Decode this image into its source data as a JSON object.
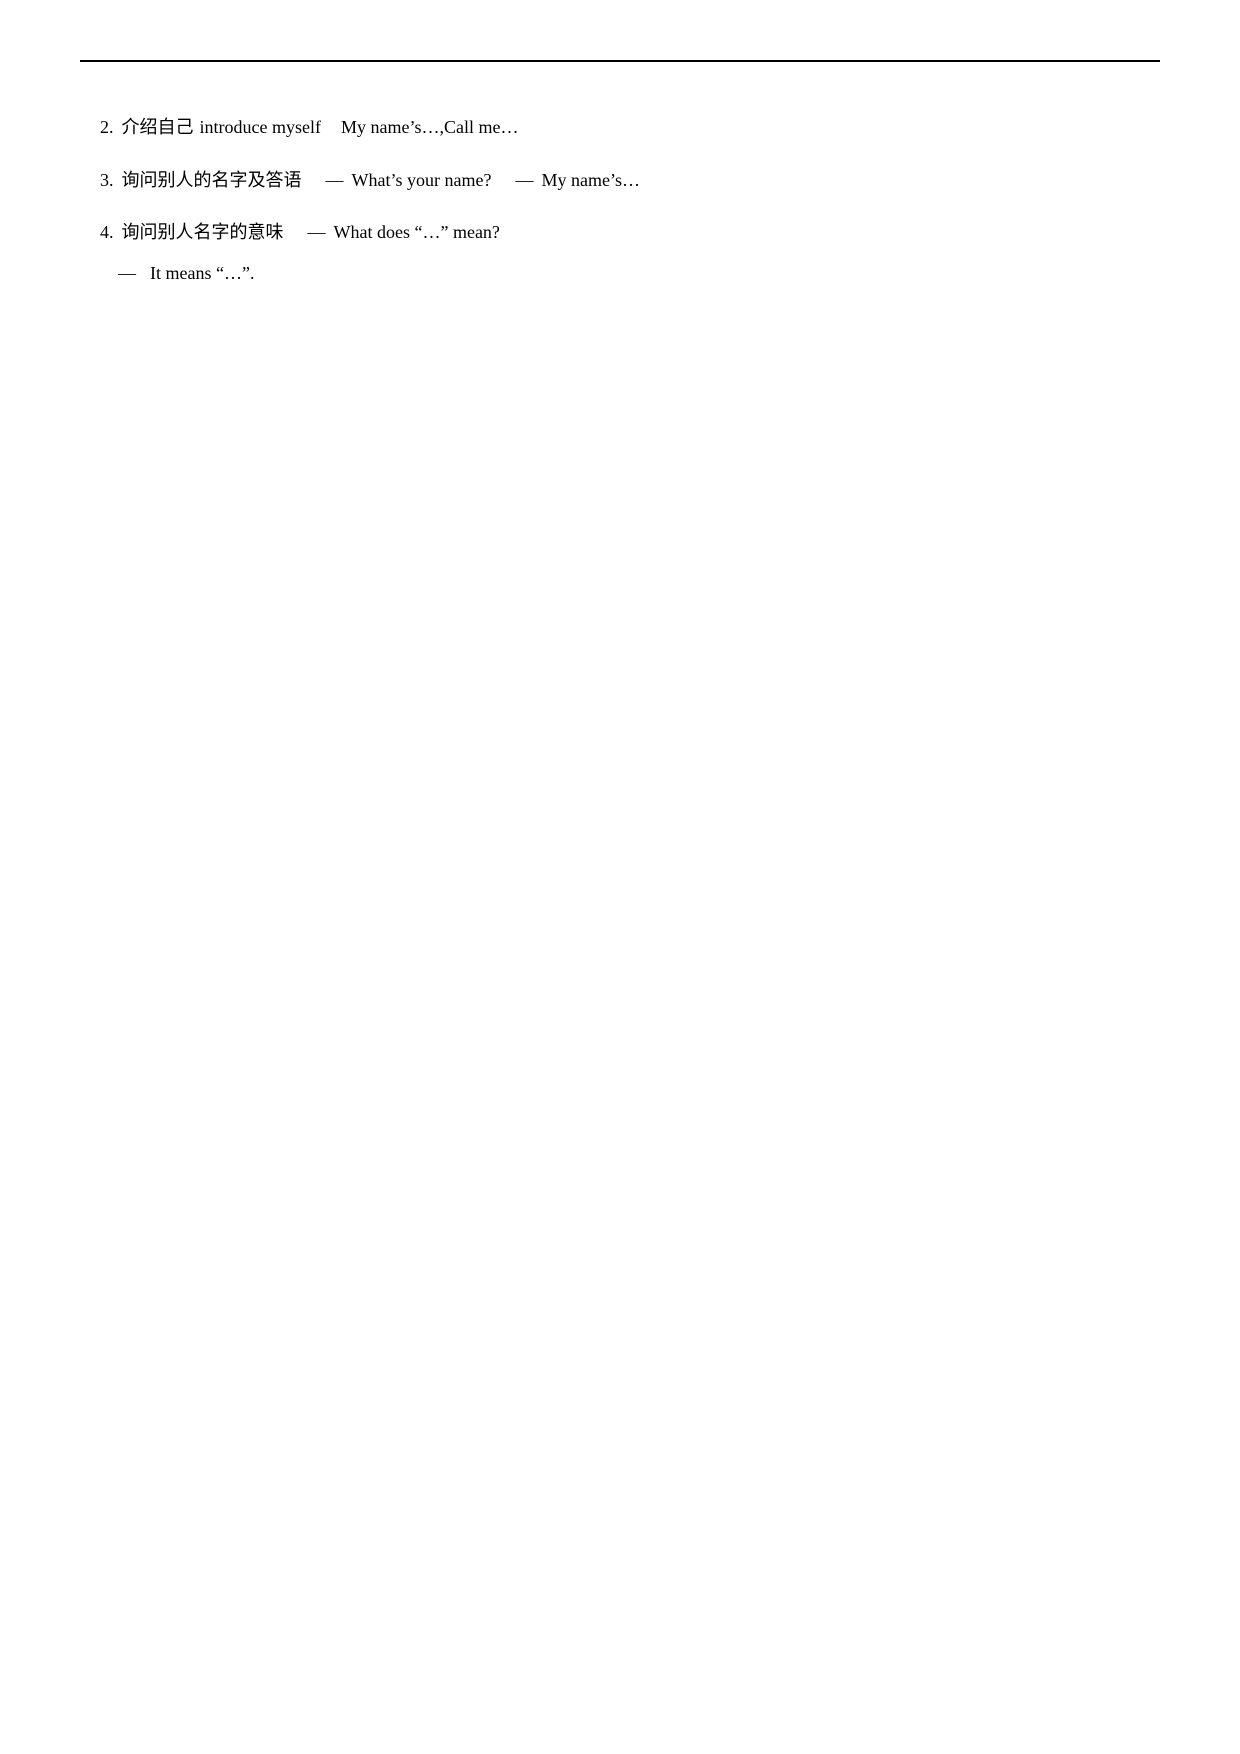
{
  "divider": true,
  "lines": [
    {
      "id": "line2",
      "number": "2.",
      "zh_text": "介绍自己",
      "en_phrase": "introduce myself",
      "content": "My name’s…,Call me…"
    },
    {
      "id": "line3",
      "number": "3.",
      "zh_text": "询问别人的名字及答语",
      "dash1": "—",
      "q1": "What’s your name?",
      "dash2": "—",
      "a1": "My name’s…"
    },
    {
      "id": "line4",
      "number": "4.",
      "zh_text": "询问别人名字的意味",
      "dash1": "—",
      "q1": "What does “…” mean?"
    },
    {
      "id": "line4answer",
      "dash": "—",
      "answer": "It means “…”."
    }
  ]
}
